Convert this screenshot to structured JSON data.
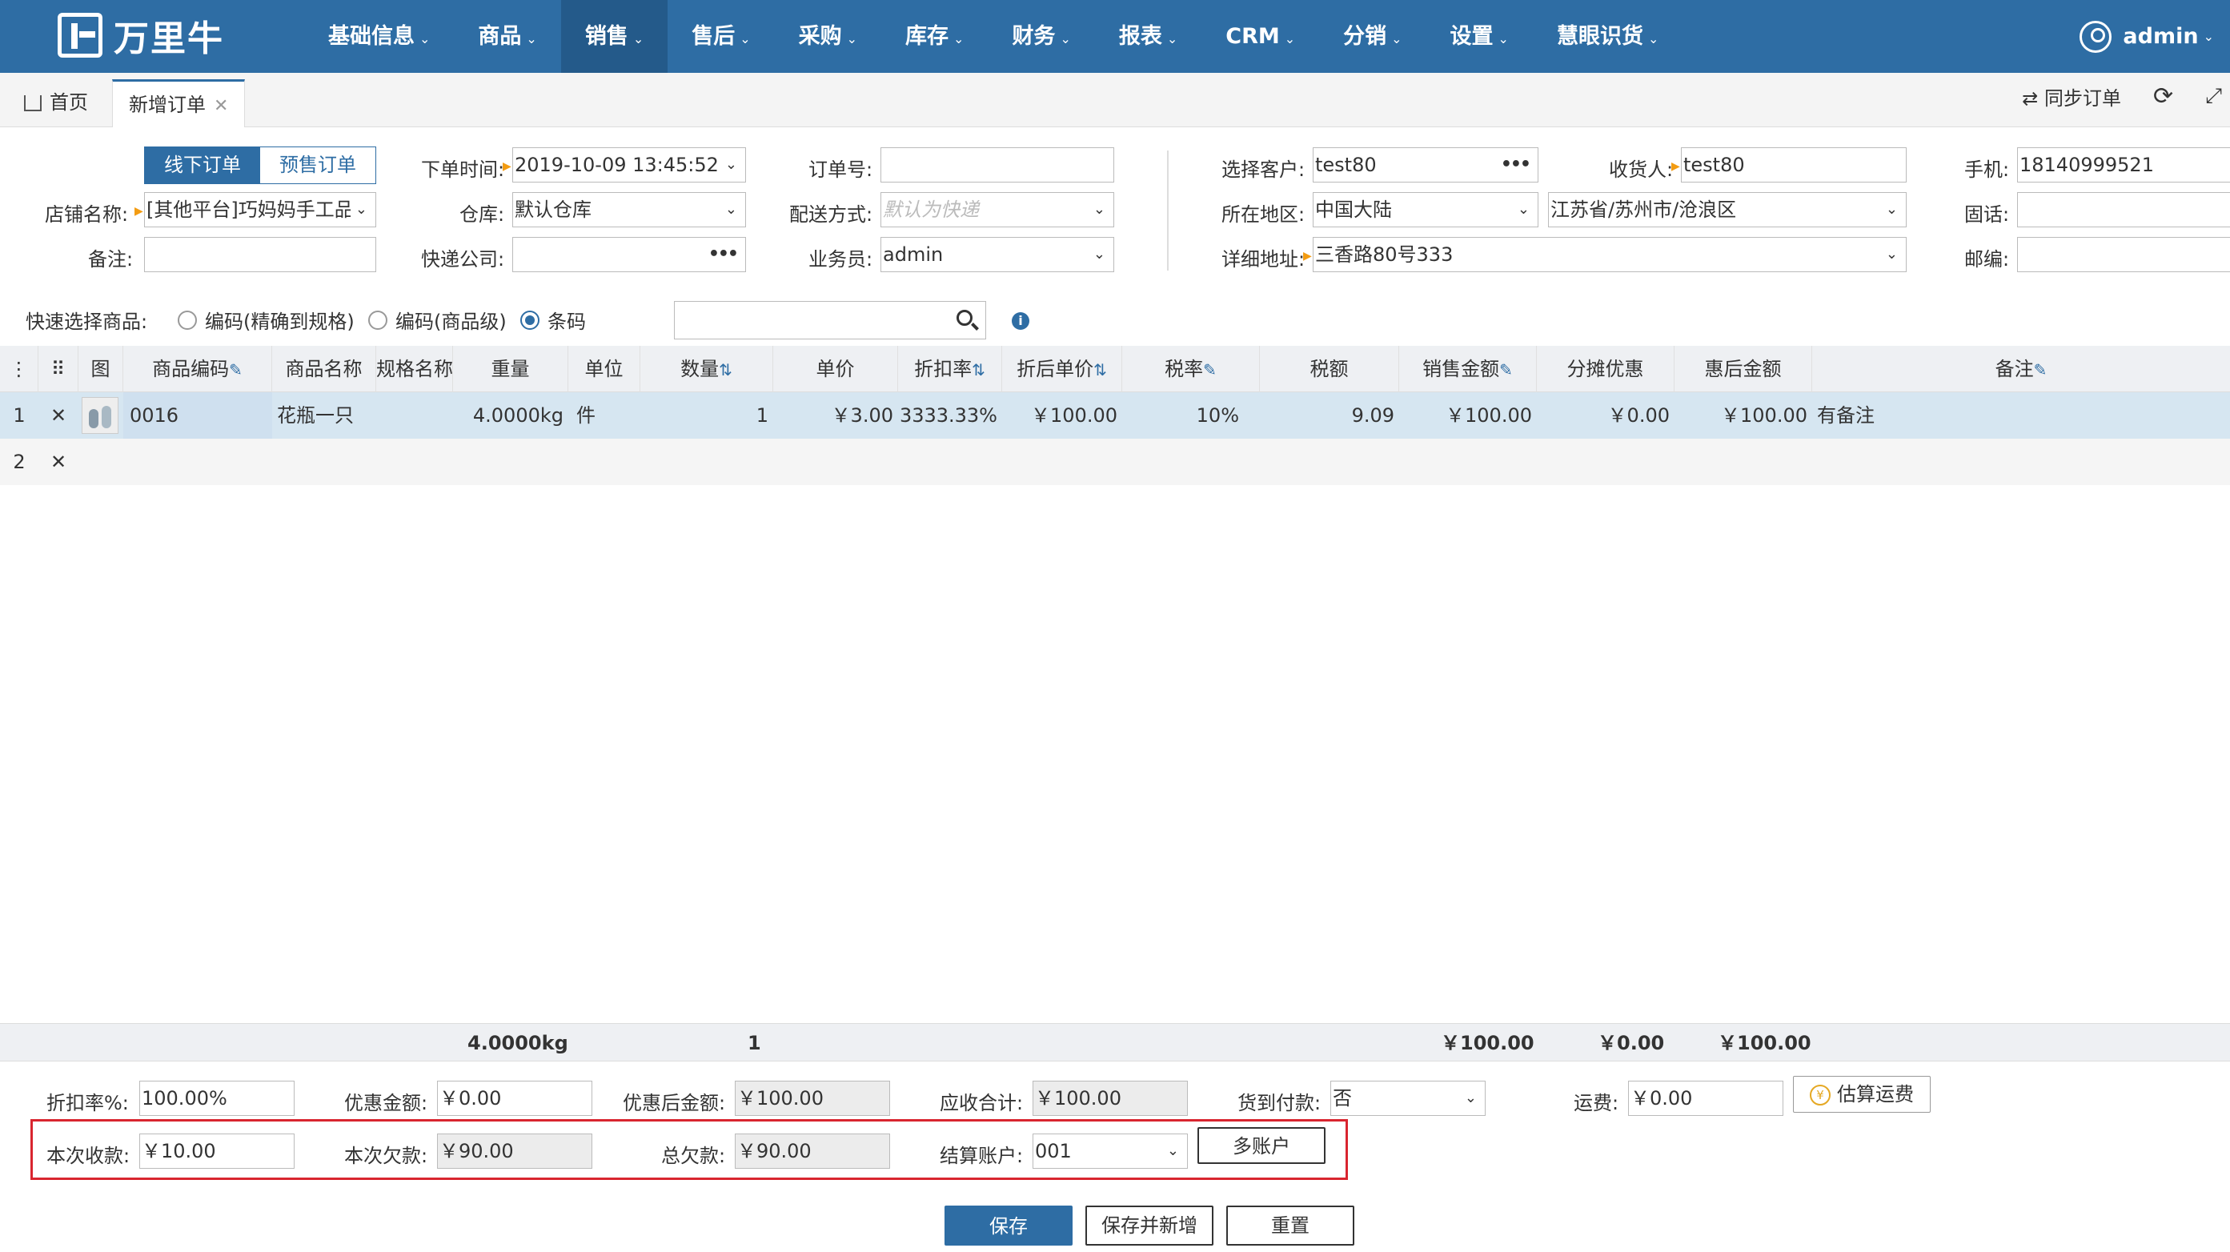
{
  "app": {
    "logo_text": "万里牛",
    "user": "admin"
  },
  "nav": {
    "items": [
      "基础信息",
      "商品",
      "销售",
      "售后",
      "采购",
      "库存",
      "财务",
      "报表",
      "CRM",
      "分销",
      "设置",
      "慧眼识货"
    ],
    "active": "销售"
  },
  "tabs": {
    "home": "首页",
    "current": "新增订单",
    "sync": "同步订单"
  },
  "order_type": {
    "offline": "线下订单",
    "presale": "预售订单"
  },
  "form": {
    "shop_label": "店铺名称:",
    "shop_value": "[其他平台]巧妈妈手工品",
    "remark_label": "备注:",
    "remark_value": "",
    "order_time_label": "下单时间:",
    "order_time_value": "2019-10-09 13:45:52",
    "warehouse_label": "仓库:",
    "warehouse_value": "默认仓库",
    "express_label": "快递公司:",
    "express_value": "",
    "order_no_label": "订单号:",
    "order_no_value": "",
    "delivery_label": "配送方式:",
    "delivery_placeholder": "默认为快递",
    "salesman_label": "业务员:",
    "salesman_value": "admin",
    "customer_label": "选择客户:",
    "customer_value": "test80",
    "region_label": "所在地区:",
    "region_country": "中国大陆",
    "region_detail": "江苏省/苏州市/沧浪区",
    "address_label": "详细地址:",
    "address_value": "三香路80号333",
    "receiver_label": "收货人:",
    "receiver_value": "test80",
    "phone_label": "手机:",
    "phone_value": "18140999521",
    "tel_label": "固话:",
    "tel_value": "",
    "zip_label": "邮编:",
    "zip_value": ""
  },
  "quick_select": {
    "label": "快速选择商品:",
    "options": [
      "编码(精确到规格)",
      "编码(商品级)",
      "条码"
    ],
    "selected": "条码"
  },
  "table": {
    "headers": [
      "图",
      "商品编码",
      "商品名称",
      "规格名称",
      "重量",
      "单位",
      "数量",
      "单价",
      "折扣率",
      "折后单价",
      "税率",
      "税额",
      "销售金额",
      "分摊优惠",
      "惠后金额",
      "备注"
    ],
    "rows": [
      {
        "index": "1",
        "code": "0016",
        "name": "花瓶一只",
        "spec": "",
        "weight": "4.0000kg",
        "unit": "件",
        "qty": "1",
        "price": "￥3.00",
        "discount": "3333.33%",
        "discounted_price": "￥100.00",
        "tax_rate": "10%",
        "tax": "9.09",
        "amount": "￥100.00",
        "share": "￥0.00",
        "after": "￥100.00",
        "note": "有备注"
      },
      {
        "index": "2"
      }
    ],
    "totals": {
      "weight": "4.0000kg",
      "qty": "1",
      "amount": "￥100.00",
      "share": "￥0.00",
      "after": "￥100.00"
    }
  },
  "summary": {
    "discount_rate_label": "折扣率%:",
    "discount_rate_value": "100.00%",
    "coupon_label": "优惠金额:",
    "coupon_value": "￥0.00",
    "after_coupon_label": "优惠后金额:",
    "after_coupon_value": "￥100.00",
    "receivable_label": "应收合计:",
    "receivable_value": "￥100.00",
    "cod_label": "货到付款:",
    "cod_value": "否",
    "freight_label": "运费:",
    "freight_value": "￥0.00",
    "estimate_freight": "估算运费",
    "received_label": "本次收款:",
    "received_value": "￥10.00",
    "owed_label": "本次欠款:",
    "owed_value": "￥90.00",
    "total_owed_label": "总欠款:",
    "total_owed_value": "￥90.00",
    "account_label": "结算账户:",
    "account_value": "001",
    "multi_account": "多账户"
  },
  "actions": {
    "save": "保存",
    "save_new": "保存并新增",
    "reset": "重置"
  },
  "colors": {
    "nav": "#2e6da4",
    "highlight": "#d9252f"
  }
}
